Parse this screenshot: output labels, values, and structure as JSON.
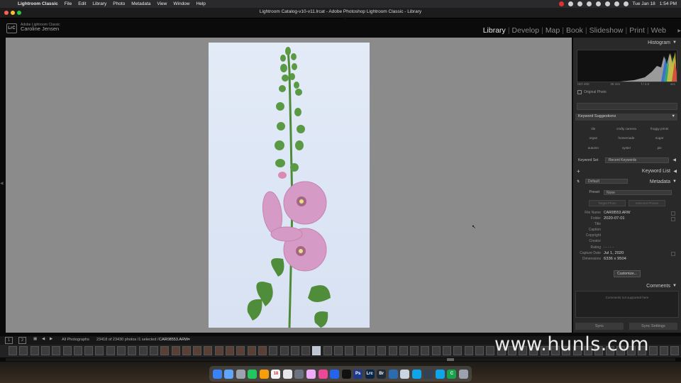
{
  "menubar": {
    "app": "Lightroom Classic",
    "items": [
      "File",
      "Edit",
      "Library",
      "Photo",
      "Metadata",
      "View",
      "Window",
      "Help"
    ],
    "date": "Tue Jan 18",
    "time": "1:54 PM"
  },
  "window": {
    "title": "Lightroom Catalog-v10-v11.lrcat - Adobe Photoshop Lightroom Classic - Library"
  },
  "identity": {
    "badge": "LrC",
    "product": "Adobe Lightroom Classic",
    "user": "Caroline Jensen"
  },
  "modules": [
    "Library",
    "Develop",
    "Map",
    "Book",
    "Slideshow",
    "Print",
    "Web"
  ],
  "active_module": "Library",
  "histogram": {
    "label": "Histogram",
    "iso": "ISO 400",
    "focal": "35 mm",
    "aperture": "f / 4.0",
    "shutter": "sec",
    "original_photo": "Original Photo"
  },
  "keyword_suggestions": {
    "label": "Keyword Suggestions",
    "items": [
      "tile",
      "crafty camera",
      "froggy prints",
      "organ",
      "homemade",
      "sugar",
      "autumn",
      "oyster",
      "pie"
    ]
  },
  "keyword_set": {
    "label": "Keyword Set",
    "value": "Recent Keywords"
  },
  "keyword_list": {
    "label": "Keyword List"
  },
  "metadata_panel": {
    "label": "Metadata",
    "default_preset": "Default",
    "preset_label": "Preset",
    "preset_value": "None",
    "target_photo_btn": "Target Photo",
    "selected_photos_btn": "Selected Photos",
    "fields": [
      {
        "k": "File Name",
        "v": "CAR08553.ARW"
      },
      {
        "k": "Folder",
        "v": "2020-07-01"
      },
      {
        "k": "Title",
        "v": ""
      },
      {
        "k": "Caption",
        "v": ""
      },
      {
        "k": "Copyright",
        "v": ""
      },
      {
        "k": "Creator",
        "v": ""
      },
      {
        "k": "Rating",
        "v": "·  ·  ·  ·  ·"
      },
      {
        "k": "Capture Date",
        "v": "Jul 1, 2020"
      },
      {
        "k": "Dimensions",
        "v": "6336 x 9504"
      }
    ],
    "customize": "Customize..."
  },
  "comments": {
    "label": "Comments",
    "note": "Comments not supported here"
  },
  "sync": {
    "left": "Sync",
    "right": "Sync Settings"
  },
  "filmstrip_bar": {
    "views": [
      "1",
      "2"
    ],
    "source": "All Photographs",
    "count": "23418 of 23430 photos /1 selected /",
    "file": "CAR08553.ARW"
  },
  "watermark": "www.hunls.com",
  "colors": {
    "panel": "#292929",
    "loupe_bg": "#8b8b8b",
    "accent_active": "#e6e6e6"
  }
}
